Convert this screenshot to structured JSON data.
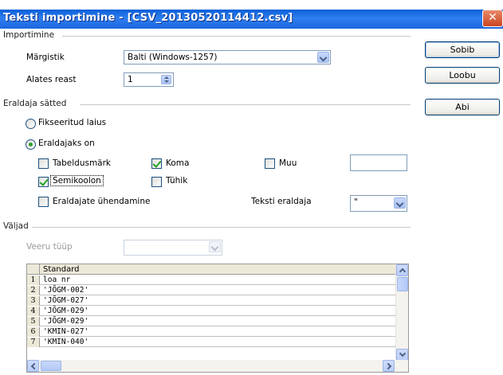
{
  "window": {
    "title": "Teksti importimine - [CSV_20130520114412.csv]",
    "close_glyph": "✕"
  },
  "import": {
    "section_label": "Importimine",
    "charset_label": "Märgistik",
    "charset_value": "Balti (Windows-1257)",
    "from_row_label": "Alates reast",
    "from_row_value": "1"
  },
  "separator": {
    "section_label": "Eraldaja sätted",
    "fixed_width_label": "Fikseeritud laius",
    "fixed_width_selected": false,
    "separated_by_label": "Eraldajaks on",
    "separated_by_selected": true,
    "tab_label": "Tabeldusmärk",
    "tab_checked": false,
    "comma_label": "Koma",
    "comma_checked": true,
    "other_label": "Muu",
    "other_checked": false,
    "other_value": "",
    "semicolon_label": "Semikoolon",
    "semicolon_checked": true,
    "space_label": "Tühik",
    "space_checked": false,
    "merge_label": "Eraldajate ühendamine",
    "merge_checked": false,
    "text_delimiter_label": "Teksti eraldaja",
    "text_delimiter_value": "\""
  },
  "fields": {
    "section_label": "Väljad",
    "column_type_label": "Veeru tüüp",
    "column_type_value": "",
    "column_header": "Standard",
    "rows": [
      {
        "n": "1",
        "value": "loa nr"
      },
      {
        "n": "2",
        "value": "'JÕGM-002'"
      },
      {
        "n": "3",
        "value": "'JÕGM-027'"
      },
      {
        "n": "4",
        "value": "'JÕGM-029'"
      },
      {
        "n": "5",
        "value": "'JÕGM-029'"
      },
      {
        "n": "6",
        "value": "'KMIN-027'"
      },
      {
        "n": "7",
        "value": "'KMIN-040'"
      }
    ]
  },
  "buttons": {
    "ok": "Sobib",
    "cancel": "Loobu",
    "help": "Abi"
  },
  "colors": {
    "titlebar": "#2f7ff0",
    "check_green": "#21a121"
  }
}
